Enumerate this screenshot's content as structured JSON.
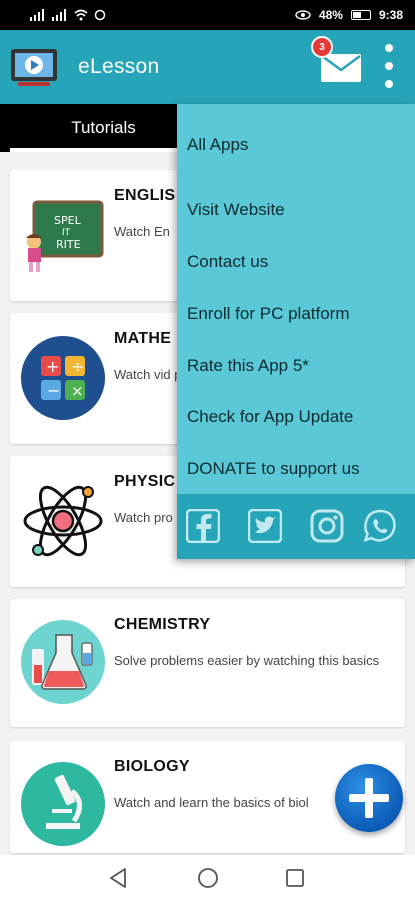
{
  "status_bar": {
    "left_icons": "signal-icons",
    "battery": "48%",
    "time": "9:38"
  },
  "app_bar": {
    "title": "eLesson",
    "mail_badge": "3"
  },
  "tabs": [
    {
      "label": "Tutorials"
    }
  ],
  "cards": [
    {
      "title": "ENGLIS",
      "desc": "Watch En"
    },
    {
      "title": "MATHE",
      "desc": "Watch vid problems"
    },
    {
      "title": "PHYSIC",
      "desc": "Watch pro"
    },
    {
      "title": "CHEMISTRY",
      "desc": "Solve problems easier by watching this basics"
    },
    {
      "title": "BIOLOGY",
      "desc": "Watch and learn the basics of biol"
    }
  ],
  "menu": {
    "items": [
      {
        "label": "All Apps"
      },
      {
        "label": "Visit Website"
      },
      {
        "label": "Contact us"
      },
      {
        "label": "Enroll for PC platform"
      },
      {
        "label": "Rate this App 5*"
      },
      {
        "label": "Check for App Update"
      },
      {
        "label": "DONATE to support us"
      }
    ],
    "social": [
      "facebook-icon",
      "twitter-icon",
      "instagram-icon",
      "whatsapp-icon"
    ]
  },
  "colors": {
    "primary": "#26a4b8",
    "menu_bg": "#5ac8d6",
    "fab": "#0b5cb6",
    "badge": "#e53935"
  }
}
